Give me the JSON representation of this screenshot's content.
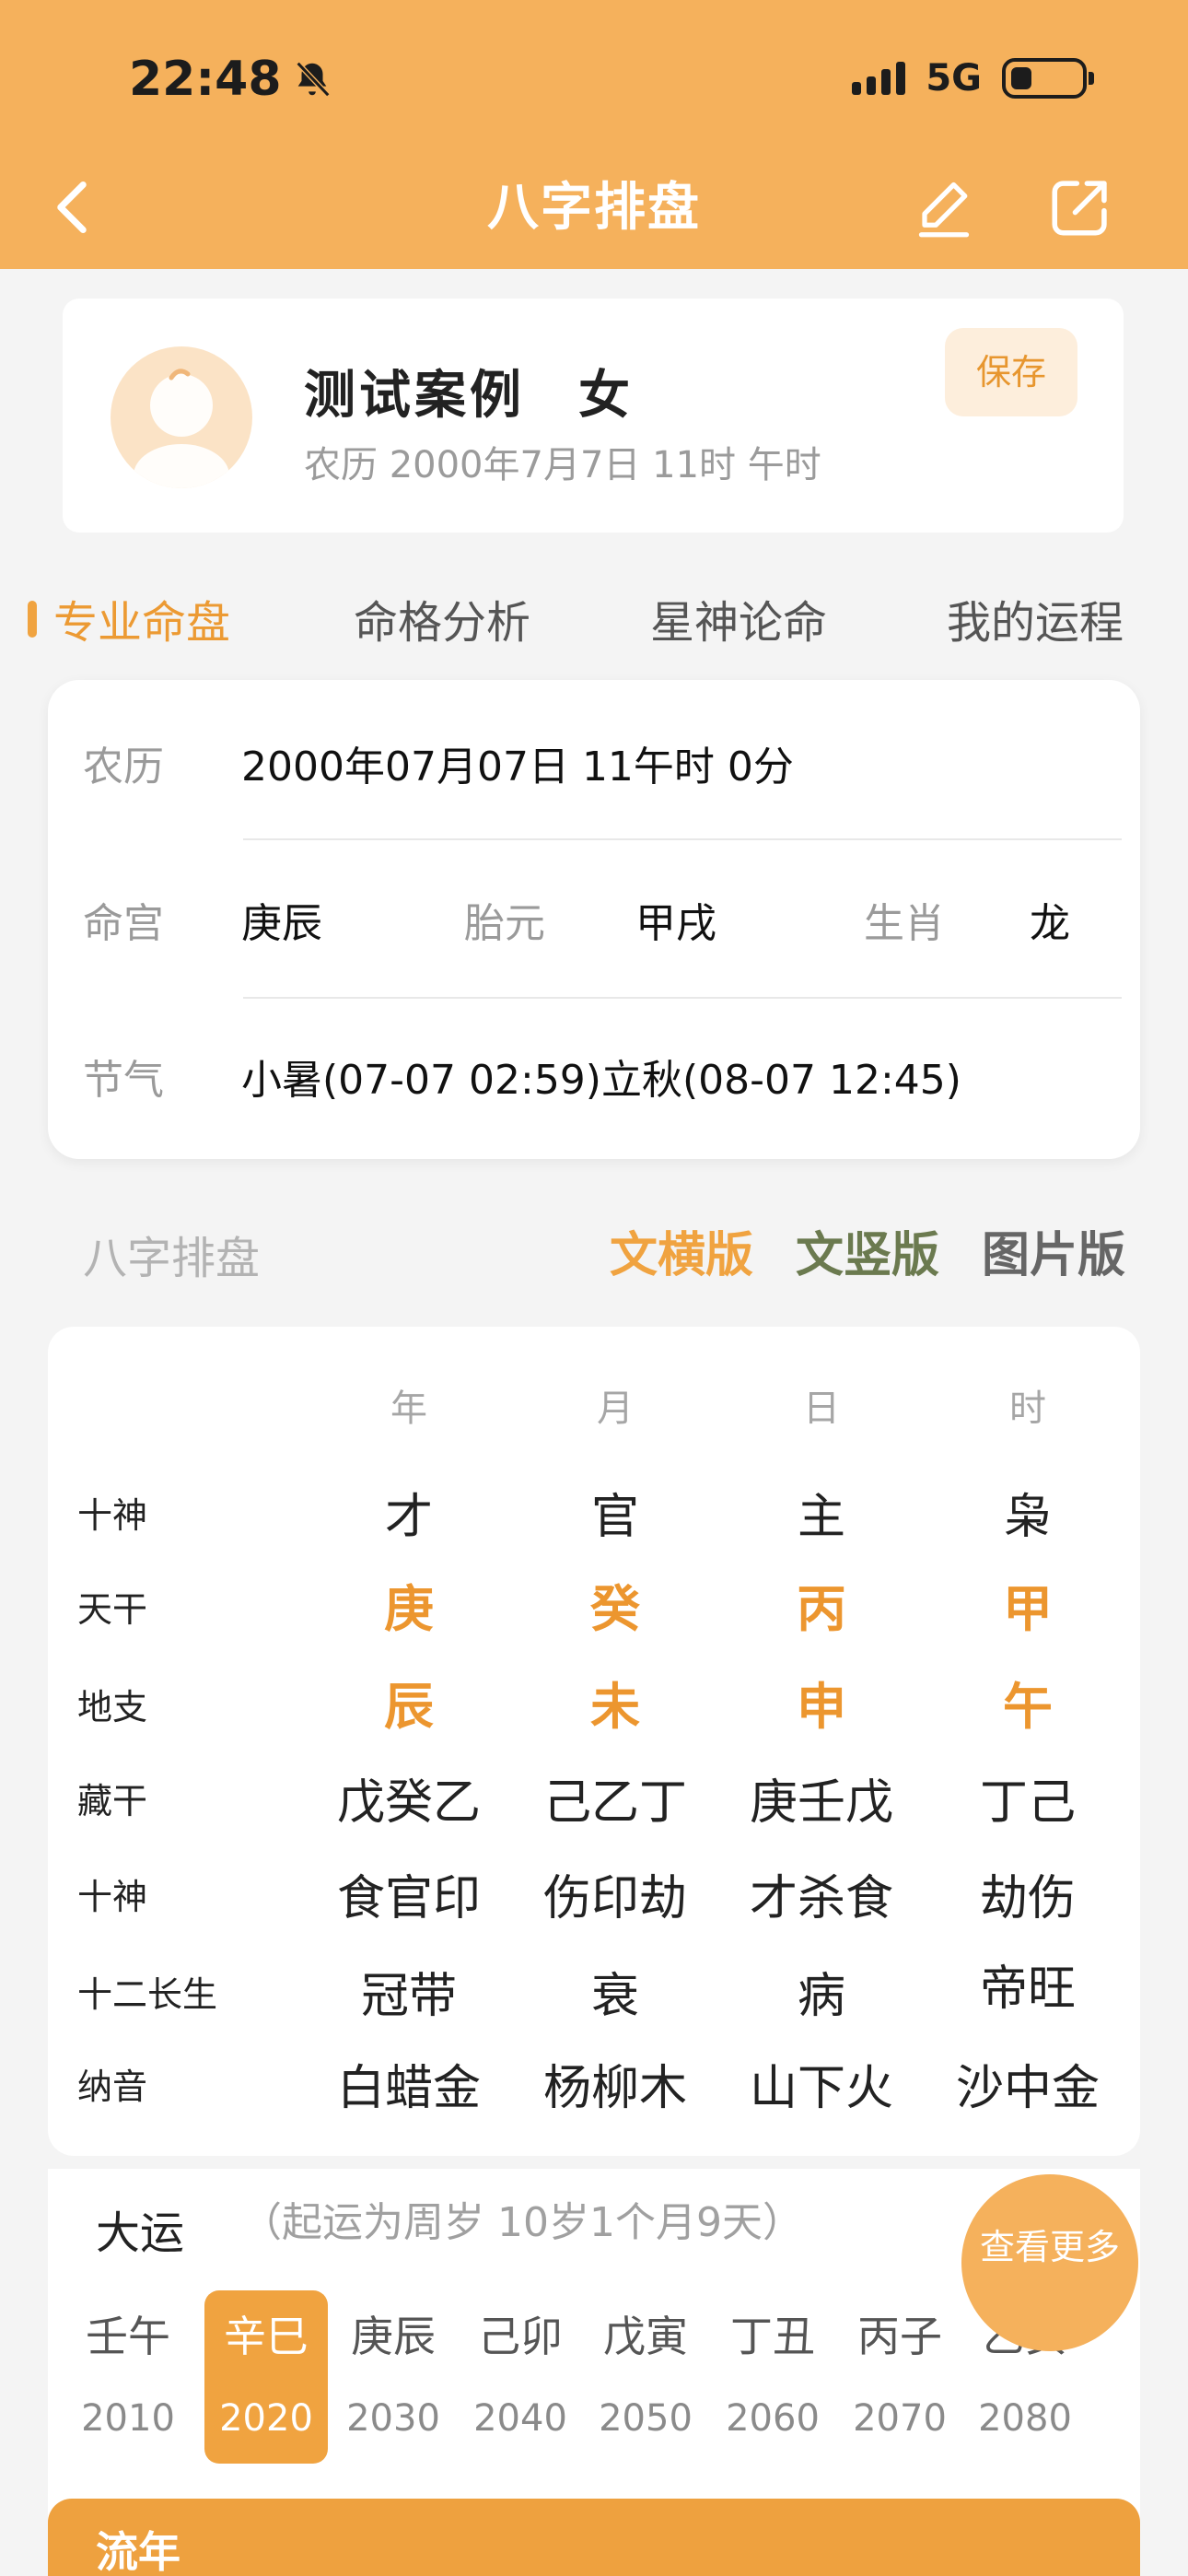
{
  "status": {
    "time": "22:48",
    "network": "5G"
  },
  "nav": {
    "title": "八字排盘"
  },
  "profile": {
    "name": "测试案例",
    "gender": "女",
    "date": "农历 2000年7月7日 11时 午时",
    "save_label": "保存"
  },
  "tabs": [
    "专业命盘",
    "命格分析",
    "星神论命",
    "我的运程"
  ],
  "info": {
    "lunar_label": "农历",
    "lunar_value": "2000年07月07日 11午时 0分",
    "minggong_label": "命宫",
    "minggong_value": "庚辰",
    "taiyuan_label": "胎元",
    "taiyuan_value": "甲戌",
    "shengxiao_label": "生肖",
    "shengxiao_value": "龙",
    "jieqi_label": "节气",
    "jieqi_value": "小暑(07-07 02:59)立秋(08-07 12:45)"
  },
  "section": {
    "title": "八字排盘",
    "versions": [
      "文横版",
      "文竖版",
      "图片版"
    ]
  },
  "chart": {
    "columns": [
      "年",
      "月",
      "日",
      "时"
    ],
    "rows": [
      {
        "label": "十神",
        "values": [
          "才",
          "官",
          "主",
          "枭"
        ]
      },
      {
        "label": "天干",
        "values": [
          "庚",
          "癸",
          "丙",
          "甲"
        ]
      },
      {
        "label": "地支",
        "values": [
          "辰",
          "未",
          "申",
          "午"
        ]
      },
      {
        "label": "藏干",
        "values": [
          "戊癸乙",
          "己乙丁",
          "庚壬戊",
          "丁己"
        ]
      },
      {
        "label": "十神",
        "values": [
          "食官印",
          "伤印劫",
          "才杀食",
          "劫伤"
        ]
      },
      {
        "label": "十二长生",
        "values": [
          "冠带",
          "衰",
          "病",
          "帝旺"
        ]
      },
      {
        "label": "纳音",
        "values": [
          "白蜡金",
          "杨柳木",
          "山下火",
          "沙中金"
        ]
      }
    ]
  },
  "dayun": {
    "title": "大运",
    "note": "（起运为周岁 10岁1个月9天）",
    "items": [
      {
        "gz": "壬午",
        "year": "2010"
      },
      {
        "gz": "辛巳",
        "year": "2020"
      },
      {
        "gz": "庚辰",
        "year": "2030"
      },
      {
        "gz": "己卯",
        "year": "2040"
      },
      {
        "gz": "戊寅",
        "year": "2050"
      },
      {
        "gz": "丁丑",
        "year": "2060"
      },
      {
        "gz": "丙子",
        "year": "2070"
      },
      {
        "gz": "乙亥",
        "year": "2080"
      }
    ],
    "see_more": "查看更多"
  },
  "liunian": {
    "title": "流年"
  },
  "colors": {
    "header": "#f5b15c",
    "accent": "#ec962f",
    "green_option": "#6b7a4f"
  }
}
